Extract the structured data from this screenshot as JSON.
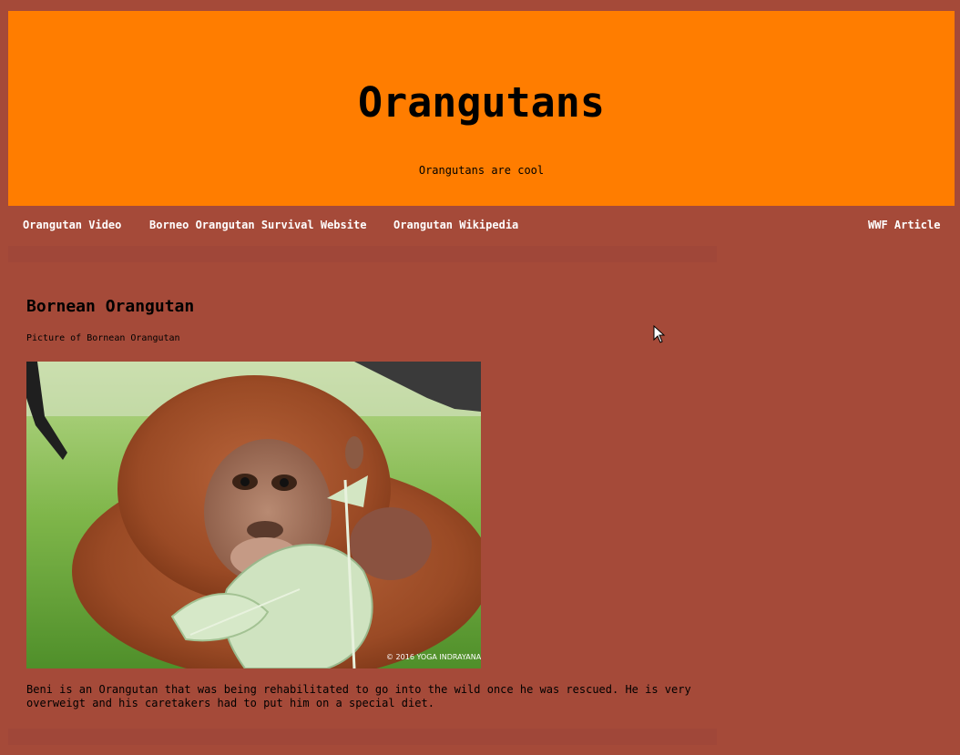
{
  "header": {
    "title": "Orangutans",
    "subtitle": "Orangutans are cool"
  },
  "nav": {
    "links": [
      {
        "label": "Orangutan Video"
      },
      {
        "label": "Borneo Orangutan Survival Website"
      },
      {
        "label": "Orangutan Wikipedia"
      },
      {
        "label": "WWF Article"
      }
    ]
  },
  "main": {
    "heading": "Bornean Orangutan",
    "caption": "Picture of Bornean Orangutan",
    "photo_watermark": "© 2016 YOGA INDRAYANA",
    "description": "Beni is an Orangutan that was being rehabilitated to go into the wild once he was rescued. He is very overweigt and his caretakers had to put him on a special diet."
  },
  "colors": {
    "background": "#a54a39",
    "header": "#ff7d00",
    "nav_text": "#ffffff"
  }
}
